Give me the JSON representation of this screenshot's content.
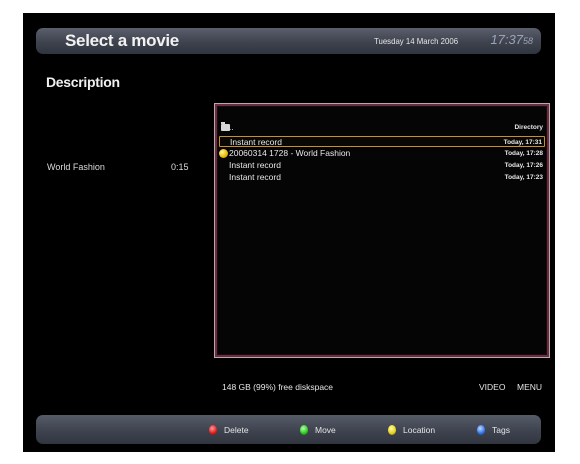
{
  "header": {
    "title": "Select a movie",
    "date": "Tuesday 14 March 2006",
    "time_main": "17:37",
    "time_seconds": "58"
  },
  "description": {
    "heading": "Description",
    "title": "World Fashion",
    "duration": "0:15"
  },
  "movie_list": {
    "rows": [
      {
        "name": "..",
        "when": "Directory",
        "icon": "folder-icon",
        "selected": false
      },
      {
        "name": "Instant record",
        "when": "Today, 17:31",
        "icon": "",
        "selected": true
      },
      {
        "name": "20060314 1728 - World Fashion",
        "when": "Today, 17:28",
        "icon": "yellow-circle-icon",
        "selected": false
      },
      {
        "name": "Instant record",
        "when": "Today, 17:26",
        "icon": "",
        "selected": false
      },
      {
        "name": "Instant record",
        "when": "Today, 17:23",
        "icon": "",
        "selected": false
      }
    ]
  },
  "status": {
    "diskspace": "148 GB (99%) free diskspace",
    "video_label": "VIDEO",
    "menu_label": "MENU"
  },
  "actions": {
    "delete": {
      "label": "Delete",
      "color": "#e01818"
    },
    "move": {
      "label": "Move",
      "color": "#28c818"
    },
    "location": {
      "label": "Location",
      "color": "#e8d010"
    },
    "tags": {
      "label": "Tags",
      "color": "#2c74e8"
    }
  }
}
